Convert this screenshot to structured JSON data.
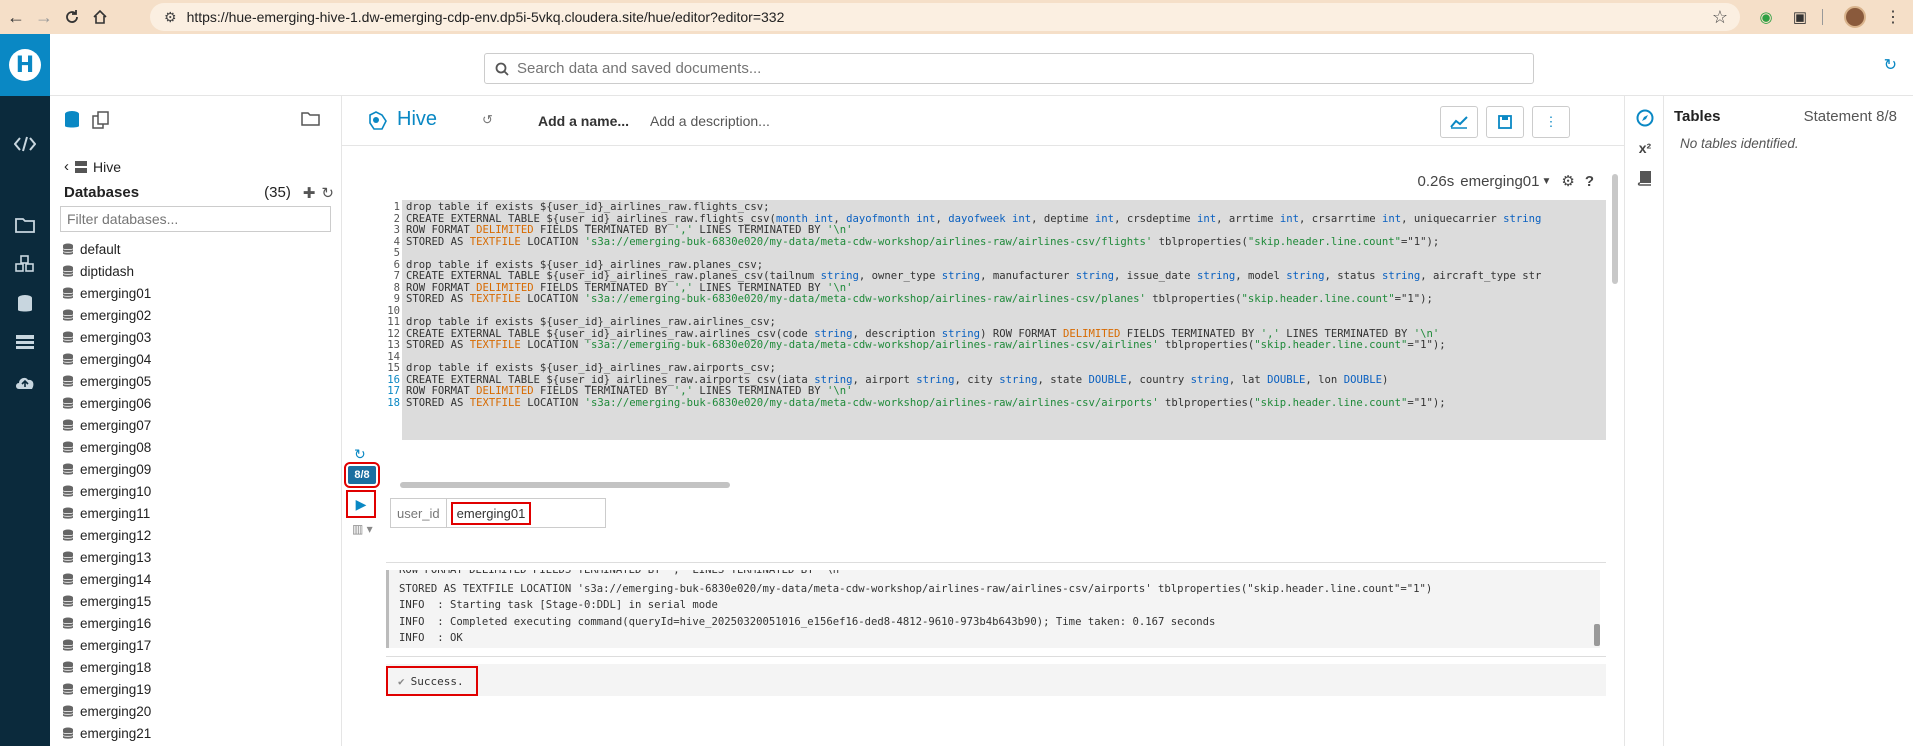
{
  "browser": {
    "url": "https://hue-emerging-hive-1.dw-emerging-cdp-env.dp5i-5vkq.cloudera.site/hue/editor?editor=332"
  },
  "header": {
    "search_placeholder": "Search data and saved documents..."
  },
  "assist": {
    "breadcrumb": "Hive",
    "databases_label": "Databases",
    "databases_count": "(35)",
    "filter_placeholder": "Filter databases...",
    "databases": [
      "default",
      "diptidash",
      "emerging01",
      "emerging02",
      "emerging03",
      "emerging04",
      "emerging05",
      "emerging06",
      "emerging07",
      "emerging08",
      "emerging09",
      "emerging10",
      "emerging11",
      "emerging12",
      "emerging13",
      "emerging14",
      "emerging15",
      "emerging16",
      "emerging17",
      "emerging18",
      "emerging19",
      "emerging20",
      "emerging21"
    ]
  },
  "editor": {
    "type_label": "Hive",
    "name_placeholder": "Add a name...",
    "description_placeholder": "Add a description...",
    "exec_time": "0.26s",
    "compute": "emerging01",
    "statement_badge": "8/8",
    "param_name": "user_id",
    "param_value": "emerging01",
    "code_lines": [
      {
        "n": "1",
        "text": "drop table if exists ${user_id}_airlines_raw.flights_csv;"
      },
      {
        "n": "2",
        "text": "CREATE EXTERNAL TABLE ${user_id}_airlines_raw.flights_csv(month int, dayofmonth int, dayofweek int, deptime int, crsdeptime int, arrtime int, crsarrtime int, uniquecarrier string"
      },
      {
        "n": "3",
        "text": "ROW FORMAT DELIMITED FIELDS TERMINATED BY ',' LINES TERMINATED BY '\\n'"
      },
      {
        "n": "4",
        "text": "STORED AS TEXTFILE LOCATION 's3a://emerging-buk-6830e020/my-data/meta-cdw-workshop/airlines-raw/airlines-csv/flights' tblproperties(\"skip.header.line.count\"=\"1\");"
      },
      {
        "n": "5",
        "text": ""
      },
      {
        "n": "6",
        "text": "drop table if exists ${user_id}_airlines_raw.planes_csv;"
      },
      {
        "n": "7",
        "text": "CREATE EXTERNAL TABLE ${user_id}_airlines_raw.planes_csv(tailnum string, owner_type string, manufacturer string, issue_date string, model string, status string, aircraft_type str"
      },
      {
        "n": "8",
        "text": "ROW FORMAT DELIMITED FIELDS TERMINATED BY ',' LINES TERMINATED BY '\\n'"
      },
      {
        "n": "9",
        "text": "STORED AS TEXTFILE LOCATION 's3a://emerging-buk-6830e020/my-data/meta-cdw-workshop/airlines-raw/airlines-csv/planes' tblproperties(\"skip.header.line.count\"=\"1\");"
      },
      {
        "n": "10",
        "text": ""
      },
      {
        "n": "11",
        "text": "drop table if exists ${user_id}_airlines_raw.airlines_csv;"
      },
      {
        "n": "12",
        "text": "CREATE EXTERNAL TABLE ${user_id}_airlines_raw.airlines_csv(code string, description string) ROW FORMAT DELIMITED FIELDS TERMINATED BY ',' LINES TERMINATED BY '\\n'"
      },
      {
        "n": "13",
        "text": "STORED AS TEXTFILE LOCATION 's3a://emerging-buk-6830e020/my-data/meta-cdw-workshop/airlines-raw/airlines-csv/airlines' tblproperties(\"skip.header.line.count\"=\"1\");"
      },
      {
        "n": "14",
        "text": ""
      },
      {
        "n": "15",
        "text": "drop table if exists ${user_id}_airlines_raw.airports_csv;"
      },
      {
        "n": "16",
        "text": "CREATE EXTERNAL TABLE ${user_id}_airlines_raw.airports_csv(iata string, airport string, city string, state DOUBLE, country string, lat DOUBLE, lon DOUBLE)"
      },
      {
        "n": "17",
        "text": "ROW FORMAT DELIMITED FIELDS TERMINATED BY ',' LINES TERMINATED BY '\\n'"
      },
      {
        "n": "18",
        "text": "STORED AS TEXTFILE LOCATION 's3a://emerging-buk-6830e020/my-data/meta-cdw-workshop/airlines-raw/airlines-csv/airports' tblproperties(\"skip.header.line.count\"=\"1\");"
      }
    ],
    "log_lines": [
      "ROW FORMAT DELIMITED FIELDS TERMINATED BY ',' LINES TERMINATED BY '\\n'",
      "STORED AS TEXTFILE LOCATION 's3a://emerging-buk-6830e020/my-data/meta-cdw-workshop/airlines-raw/airlines-csv/airports' tblproperties(\"skip.header.line.count\"=\"1\")",
      "INFO  : Starting task [Stage-0:DDL] in serial mode",
      "INFO  : Completed executing command(queryId=hive_20250320051016_e156ef16-ded8-4812-9610-973b4b643b90); Time taken: 0.167 seconds",
      "INFO  : OK"
    ],
    "success_text": "Success."
  },
  "right_panel": {
    "title": "Tables",
    "statement": "Statement 8/8",
    "empty": "No tables identified."
  },
  "colors": {
    "brand": "#0a88c4",
    "rail": "#0b2a3c",
    "highlight_box": "#e00000"
  }
}
